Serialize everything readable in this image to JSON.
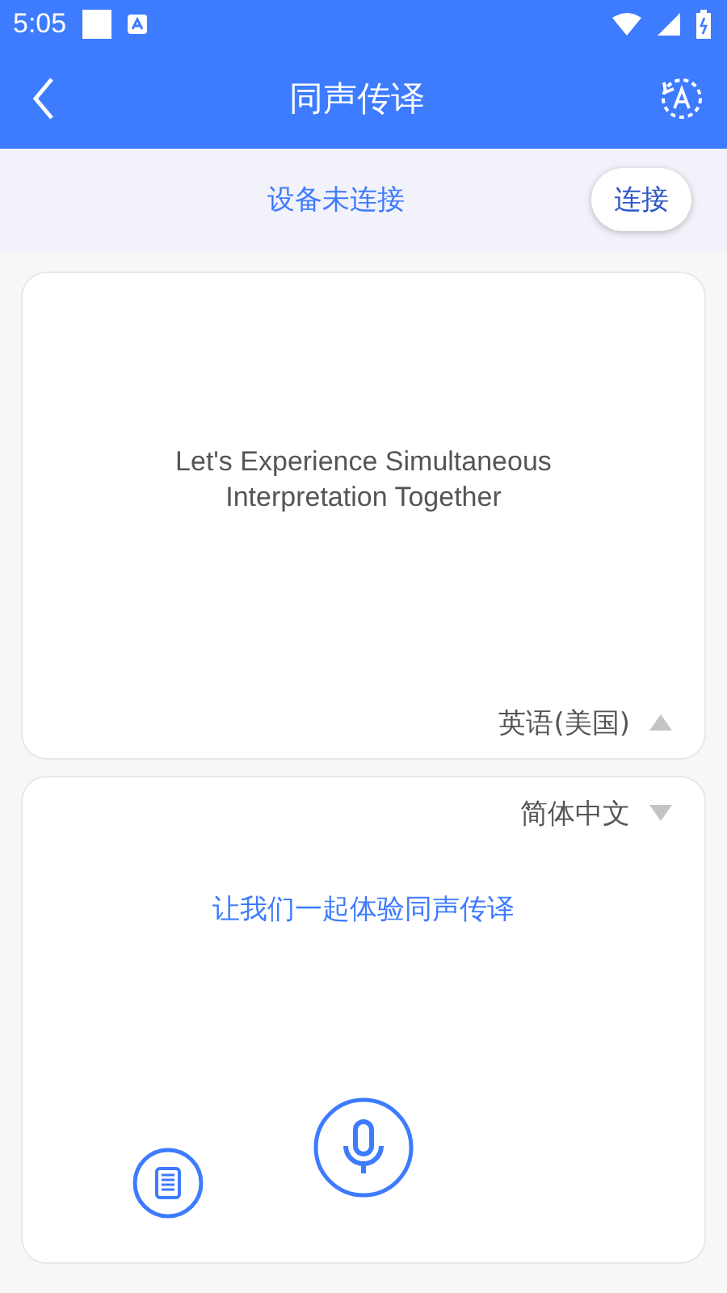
{
  "status_bar": {
    "time": "5:05"
  },
  "app_bar": {
    "title": "同声传译"
  },
  "connection": {
    "status": "设备未连接",
    "button": "连接"
  },
  "panels": [
    {
      "kind": "source",
      "text": "Let's Experience Simultaneous Interpretation Together",
      "language": "英语(美国)"
    },
    {
      "kind": "target",
      "text": "让我们一起体验同声传译",
      "language": "简体中文"
    }
  ]
}
